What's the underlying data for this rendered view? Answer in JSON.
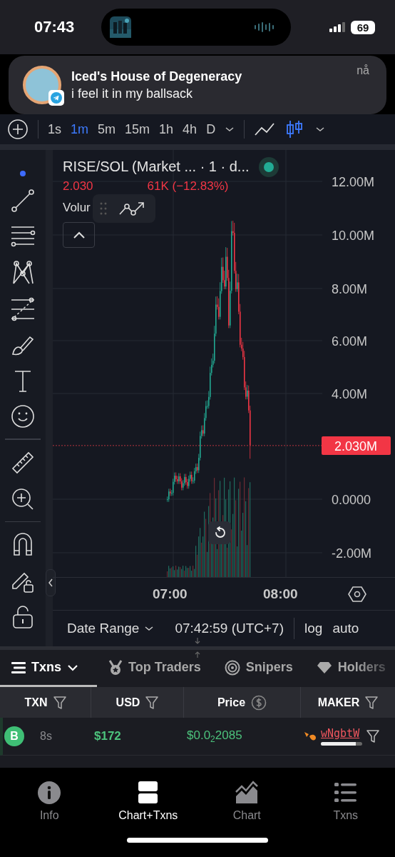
{
  "status_bar": {
    "time": "07:43",
    "battery": "69"
  },
  "notification": {
    "title": "Iced's House of Degeneracy",
    "message": "i feel it in my ballsack",
    "time": "nå"
  },
  "intervals": [
    {
      "label": "1s",
      "selected": false
    },
    {
      "label": "1m",
      "selected": true
    },
    {
      "label": "5m",
      "selected": false
    },
    {
      "label": "15m",
      "selected": false
    },
    {
      "label": "1h",
      "selected": false
    },
    {
      "label": "4h",
      "selected": false
    },
    {
      "label": "D",
      "selected": false
    }
  ],
  "chart_styles": [
    {
      "kind": "line",
      "selected": false
    },
    {
      "kind": "candles",
      "selected": true
    }
  ],
  "chart": {
    "title": "RISE/SOL (Market ... · 1 · d...",
    "live": true,
    "change_start": "2.030",
    "change_end": "61K (−12.83%)",
    "volume_label": "Volur",
    "y_labels": [
      "12.00M",
      "10.00M",
      "8.00M",
      "6.00M",
      "4.00M",
      "0.0000",
      "-2.00M"
    ],
    "price_tag": "2.030M",
    "x_labels": [
      "07:00",
      "08:00"
    ]
  },
  "footer": {
    "date_range": "Date Range",
    "time": "07:42:59 (UTC+7)",
    "scale_options": [
      "log",
      "auto"
    ]
  },
  "tabs": [
    {
      "label": "Txns",
      "selected": true
    },
    {
      "label": "Top Traders",
      "selected": false
    },
    {
      "label": "Snipers",
      "selected": false
    },
    {
      "label": "Holders",
      "selected": false
    }
  ],
  "table": {
    "columns": [
      {
        "label": "TXN",
        "kind": "filter"
      },
      {
        "label": "USD",
        "kind": "filter"
      },
      {
        "label": "Price",
        "kind": "currency"
      },
      {
        "label": "MAKER",
        "kind": "filter"
      }
    ],
    "rows": [
      {
        "side": "B",
        "color": "#3fbf75",
        "age": "8s",
        "usd": "$172",
        "price": "$0.0$_{2}$2085",
        "maker": "wNgbtW"
      }
    ]
  },
  "nav": [
    {
      "label": "Info",
      "selected": false
    },
    {
      "label": "Chart+Txns",
      "selected": true
    },
    {
      "label": "Chart",
      "selected": false
    },
    {
      "label": "Txns",
      "selected": false
    }
  ]
}
